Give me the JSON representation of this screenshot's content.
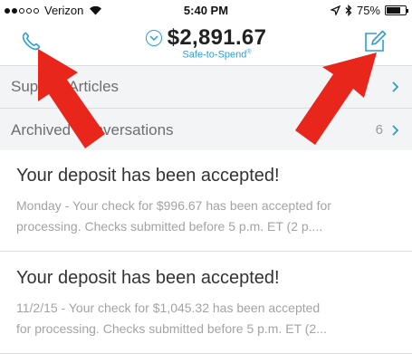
{
  "status_bar": {
    "carrier": "Verizon",
    "time": "5:40 PM",
    "battery_percent": "75%",
    "battery_level": 0.75,
    "signal_bars_filled": 2,
    "signal_bars_total": 5
  },
  "header": {
    "balance": "$2,891.67",
    "balance_caption": "Safe-to-Spend",
    "balance_caption_mark": "®",
    "left_icon": "phone-icon",
    "right_icon": "compose-icon"
  },
  "rows": [
    {
      "label": "Support Articles",
      "count": ""
    },
    {
      "label": "Archived Conversations",
      "count": "6"
    }
  ],
  "messages": [
    {
      "title": "Your deposit has been accepted!",
      "line1": "Monday - Your check for $996.67 has been accepted for",
      "line2": "processing. Checks submitted before 5 p.m. ET (2 p...."
    },
    {
      "title": "Your deposit has been accepted!",
      "line1": "11/2/15 - Your check for $1,045.32 has been accepted",
      "line2": "for processing. Checks submitted before 5 p.m. ET (2..."
    }
  ],
  "colors": {
    "accent": "#2a9fd6",
    "arrow": "#e8261c"
  }
}
